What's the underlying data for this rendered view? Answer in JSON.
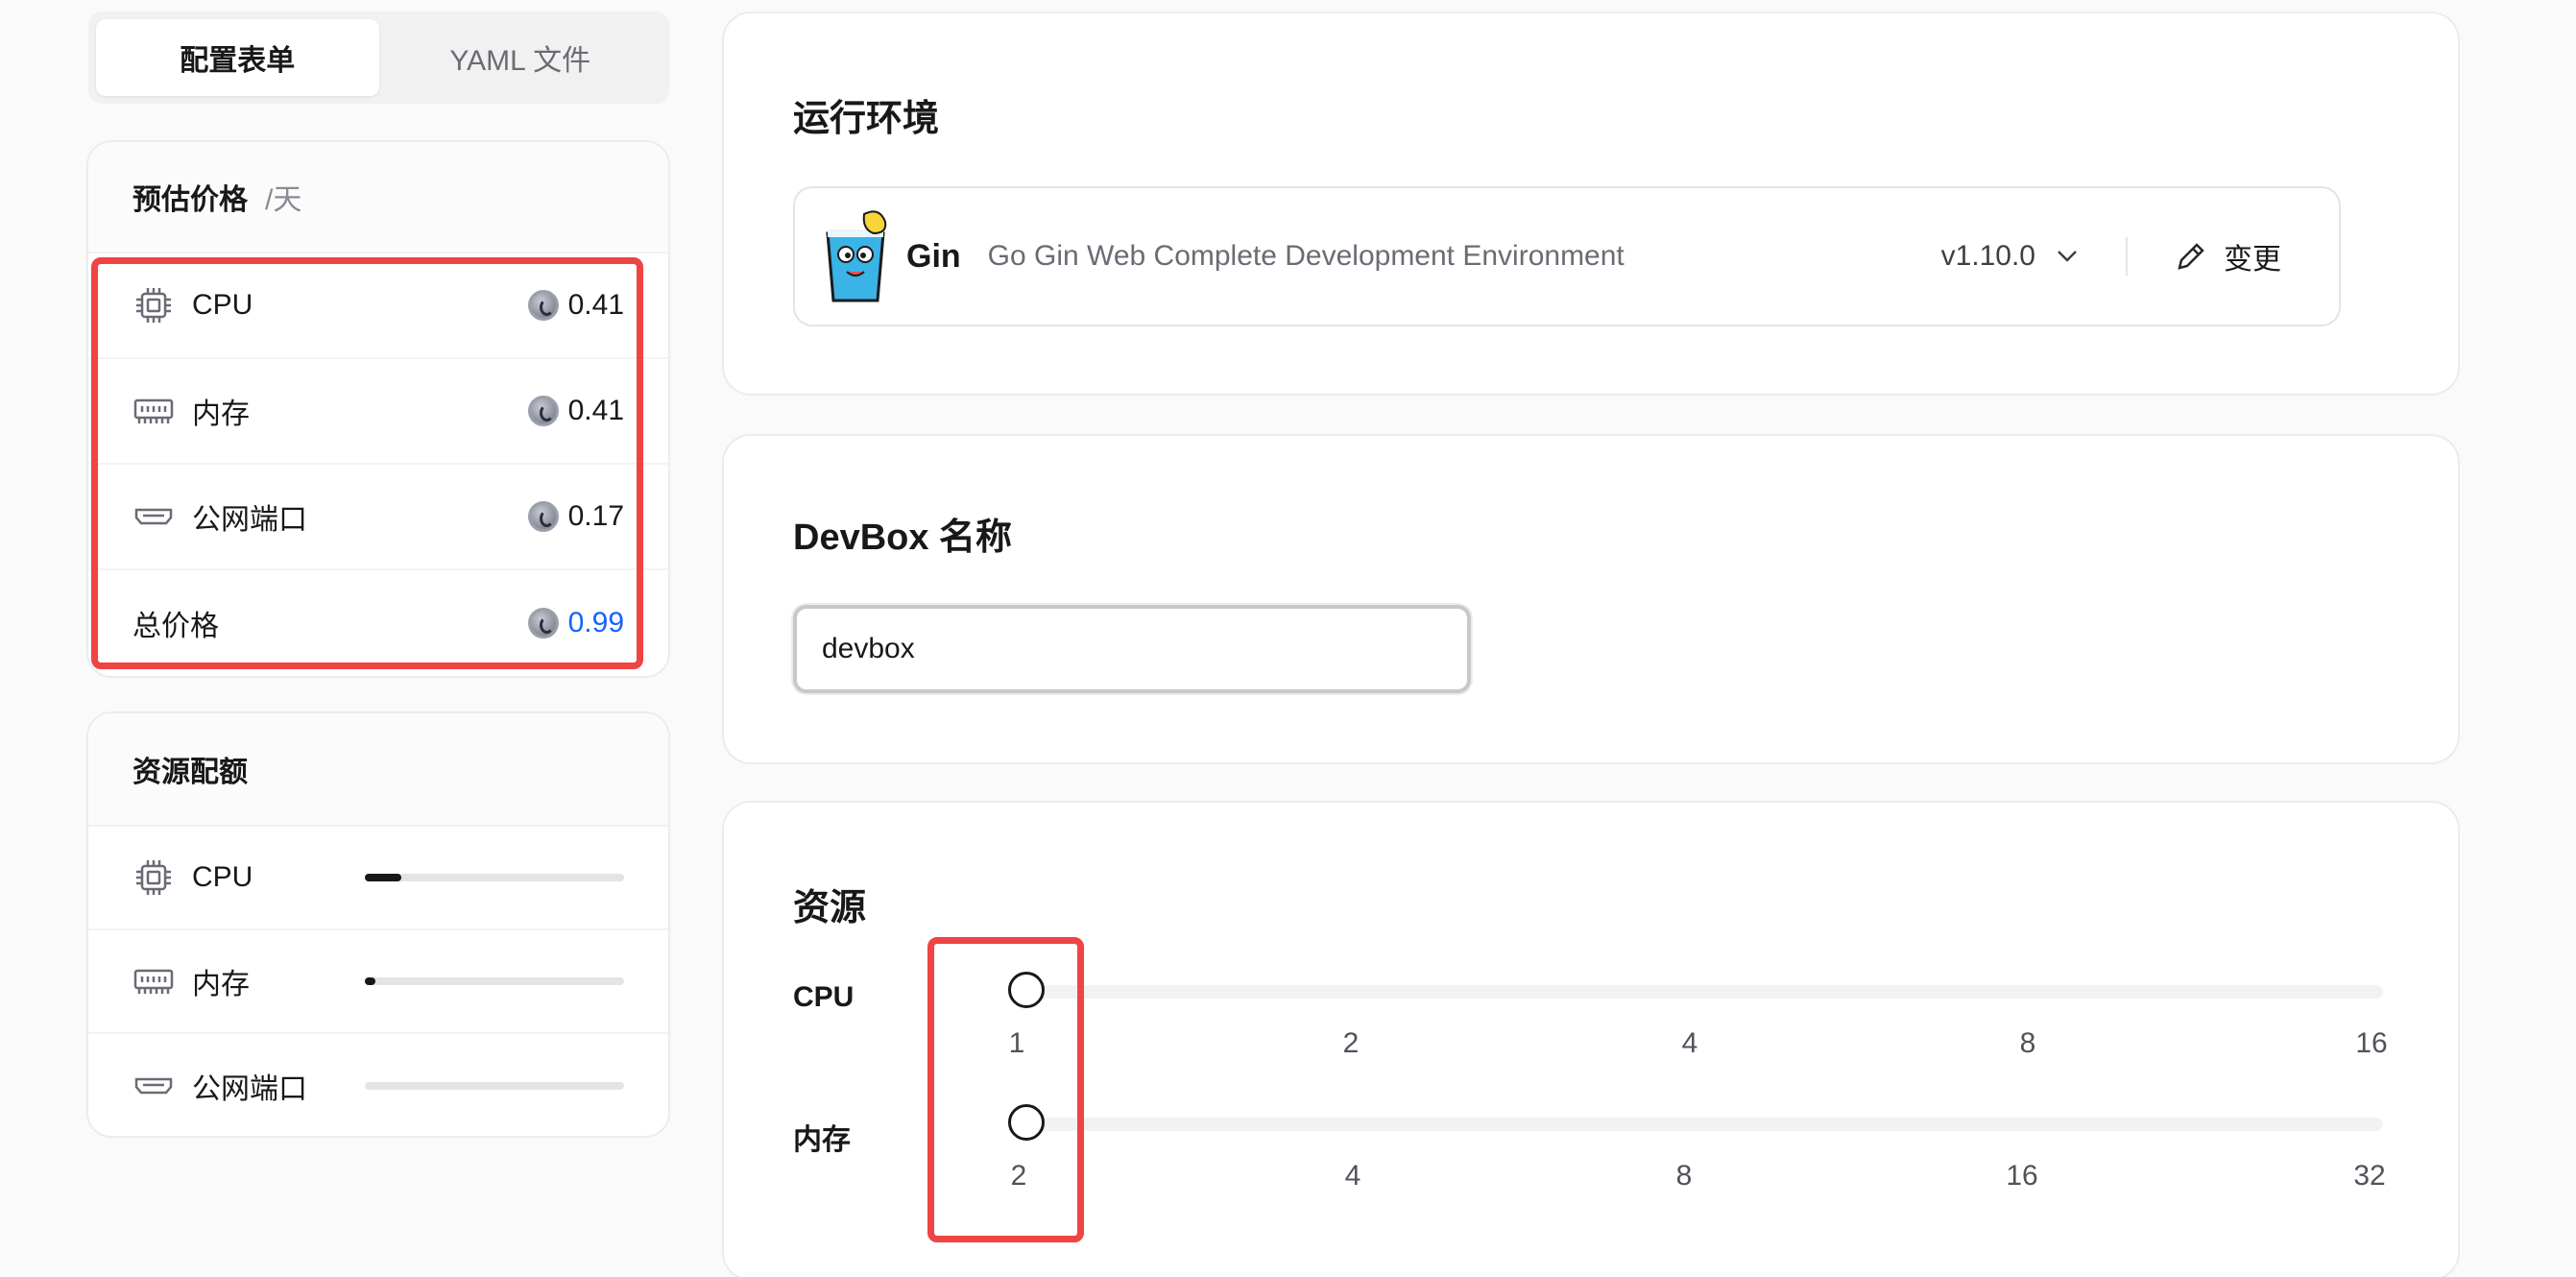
{
  "tabs": [
    {
      "label": "配置表单",
      "active": true
    },
    {
      "label": "YAML 文件",
      "active": false
    }
  ],
  "price": {
    "title": "预估价格",
    "unit": "/天",
    "items": [
      {
        "icon": "cpu-icon",
        "label": "CPU",
        "value": "0.41"
      },
      {
        "icon": "memory-icon",
        "label": "内存",
        "value": "0.41"
      },
      {
        "icon": "port-icon",
        "label": "公网端口",
        "value": "0.17"
      }
    ],
    "total_label": "总价格",
    "total_value": "0.99",
    "total_color": "#1463ff"
  },
  "quota": {
    "title": "资源配额",
    "items": [
      {
        "icon": "cpu-icon",
        "label": "CPU",
        "usage": 0.14
      },
      {
        "icon": "memory-icon",
        "label": "内存",
        "usage": 0.04
      },
      {
        "icon": "port-icon",
        "label": "公网端口",
        "usage": 0
      }
    ]
  },
  "runtime": {
    "title": "运行环境",
    "name": "Gin",
    "description": "Go Gin Web Complete Development Environment",
    "version": "v1.10.0",
    "change_label": "变更"
  },
  "devbox": {
    "title": "DevBox 名称",
    "value": "devbox"
  },
  "resources": {
    "title": "资源",
    "cpu": {
      "label": "CPU",
      "ticks": [
        "1",
        "2",
        "4",
        "8",
        "16"
      ],
      "selected": "1"
    },
    "memory": {
      "label": "内存",
      "ticks": [
        "2",
        "4",
        "8",
        "16",
        "32"
      ],
      "selected": "2"
    }
  },
  "highlight_color": "#ef4444"
}
